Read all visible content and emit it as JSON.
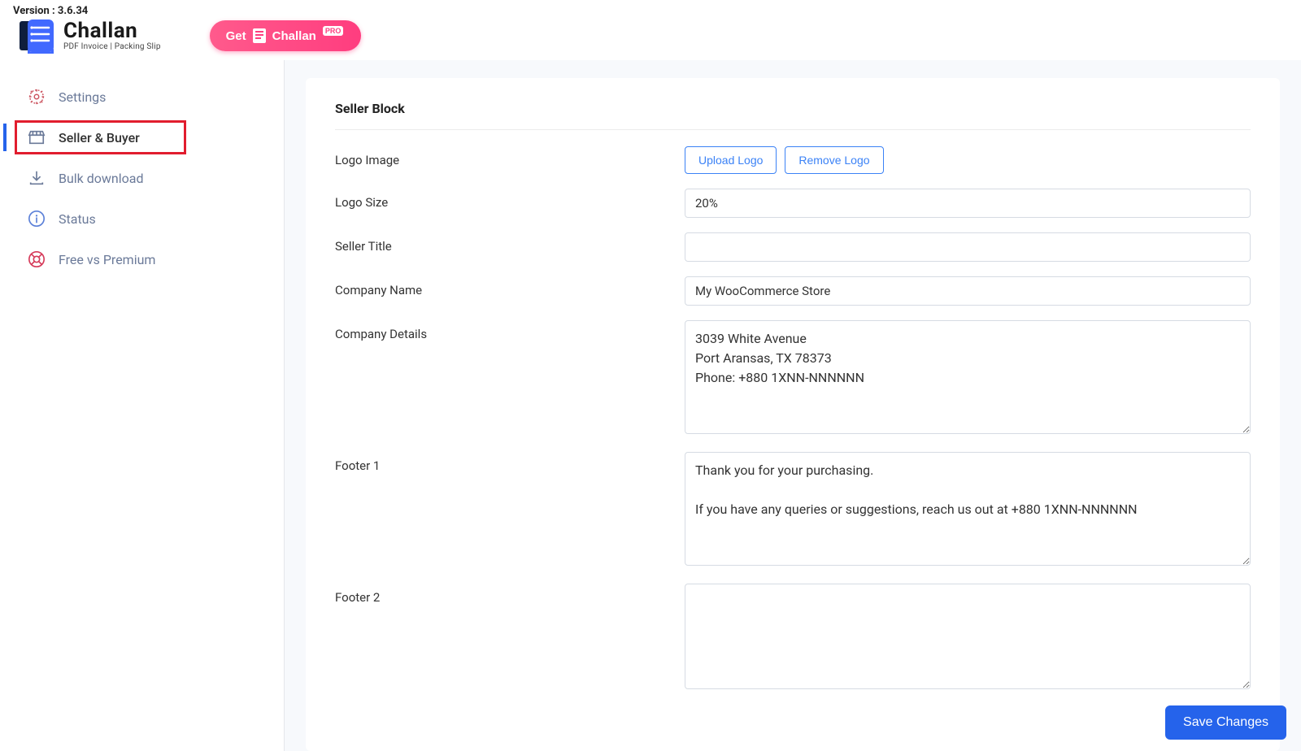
{
  "version_label": "Version : 3.6.34",
  "brand": {
    "title": "Challan",
    "subtitle": "PDF Invoice | Packing Slip"
  },
  "get_pro": {
    "prefix": "Get",
    "label": "Challan",
    "badge": "PRO"
  },
  "sidebar": {
    "items": [
      {
        "label": "Settings"
      },
      {
        "label": "Seller & Buyer"
      },
      {
        "label": "Bulk download"
      },
      {
        "label": "Status"
      },
      {
        "label": "Free vs Premium"
      }
    ]
  },
  "panel": {
    "title": "Seller Block",
    "logo_image_label": "Logo Image",
    "upload_logo_btn": "Upload Logo",
    "remove_logo_btn": "Remove Logo",
    "logo_size_label": "Logo Size",
    "logo_size_value": "20%",
    "seller_title_label": "Seller Title",
    "seller_title_value": "",
    "company_name_label": "Company Name",
    "company_name_value": "My WooCommerce Store",
    "company_details_label": "Company Details",
    "company_details_value": "3039 White Avenue\nPort Aransas, TX 78373\nPhone: +880 1XNN-NNNNNN",
    "footer1_label": "Footer 1",
    "footer1_value": "Thank you for your purchasing.\n\nIf you have any queries or suggestions, reach us out at +880 1XNN-NNNNNN",
    "footer2_label": "Footer 2",
    "footer2_value": ""
  },
  "save_button": "Save Changes"
}
